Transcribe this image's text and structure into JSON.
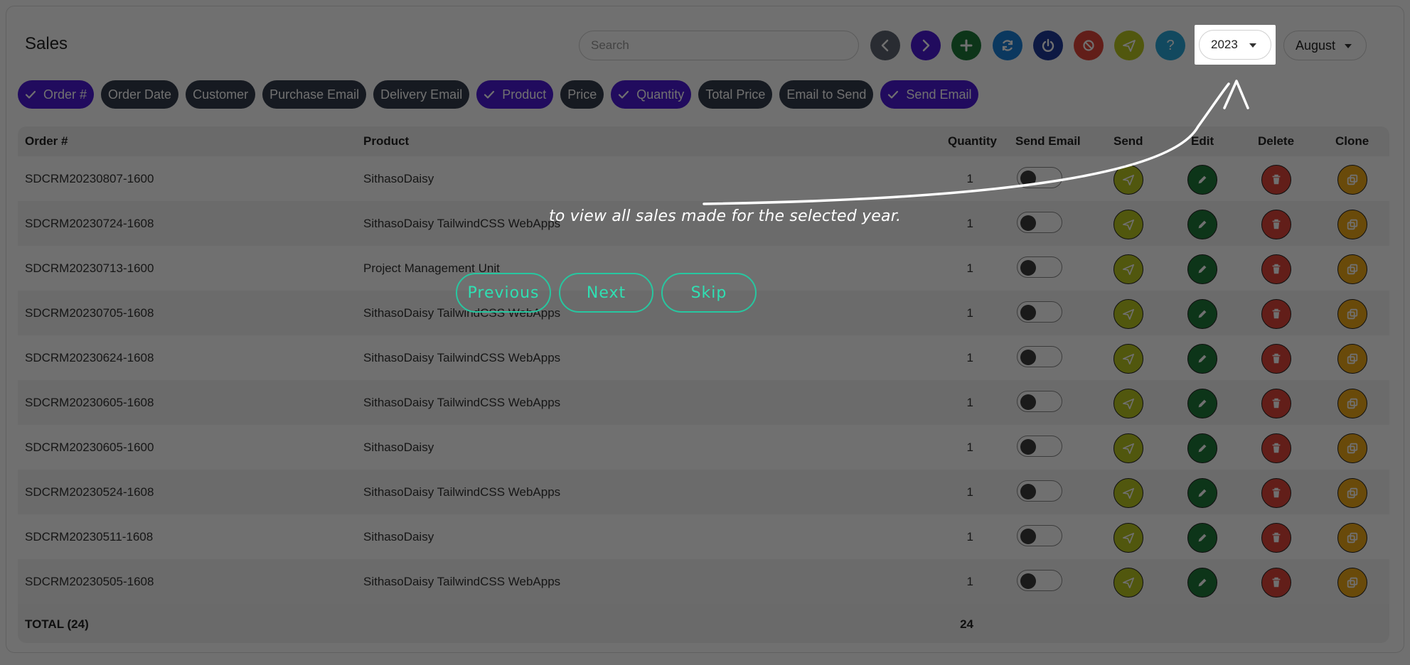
{
  "page": {
    "title": "Sales"
  },
  "search": {
    "placeholder": "Search"
  },
  "toolbar": {
    "buttons": [
      {
        "icon": "chevron-left-icon",
        "color": "#5d6472"
      },
      {
        "icon": "chevron-right-icon",
        "color": "#4c1bd6"
      },
      {
        "icon": "plus-icon",
        "color": "#1f7a3a"
      },
      {
        "icon": "refresh-icon",
        "color": "#1a7fd9"
      },
      {
        "icon": "power-icon",
        "color": "#1e3a9a"
      },
      {
        "icon": "ban-icon",
        "color": "#e0453a"
      },
      {
        "icon": "send-icon",
        "color": "#b8c620"
      },
      {
        "icon": "help-icon",
        "label": "?",
        "color": "#2aa7d8"
      }
    ]
  },
  "filters": {
    "year": "2023",
    "month": "August"
  },
  "columns_toggle": [
    {
      "label": "Order #",
      "active": true
    },
    {
      "label": "Order Date",
      "active": false
    },
    {
      "label": "Customer",
      "active": false
    },
    {
      "label": "Purchase Email",
      "active": false
    },
    {
      "label": "Delivery Email",
      "active": false
    },
    {
      "label": "Product",
      "active": true
    },
    {
      "label": "Price",
      "active": false
    },
    {
      "label": "Quantity",
      "active": true
    },
    {
      "label": "Total Price",
      "active": false
    },
    {
      "label": "Email to Send",
      "active": false
    },
    {
      "label": "Send Email",
      "active": true
    }
  ],
  "table": {
    "headers": {
      "order": "Order #",
      "product": "Product",
      "quantity": "Quantity",
      "send_email": "Send Email",
      "send": "Send",
      "edit": "Edit",
      "delete": "Delete",
      "clone": "Clone"
    },
    "rows": [
      {
        "order": "SDCRM20230807-1600",
        "product": "SithasoDaisy",
        "quantity": "1"
      },
      {
        "order": "SDCRM20230724-1608",
        "product": "SithasoDaisy TailwindCSS WebApps",
        "quantity": "1"
      },
      {
        "order": "SDCRM20230713-1600",
        "product": "Project Management Unit",
        "quantity": "1"
      },
      {
        "order": "SDCRM20230705-1608",
        "product": "SithasoDaisy TailwindCSS WebApps",
        "quantity": "1"
      },
      {
        "order": "SDCRM20230624-1608",
        "product": "SithasoDaisy TailwindCSS WebApps",
        "quantity": "1"
      },
      {
        "order": "SDCRM20230605-1608",
        "product": "SithasoDaisy TailwindCSS WebApps",
        "quantity": "1"
      },
      {
        "order": "SDCRM20230605-1600",
        "product": "SithasoDaisy",
        "quantity": "1"
      },
      {
        "order": "SDCRM20230524-1608",
        "product": "SithasoDaisy TailwindCSS WebApps",
        "quantity": "1"
      },
      {
        "order": "SDCRM20230511-1608",
        "product": "SithasoDaisy",
        "quantity": "1"
      },
      {
        "order": "SDCRM20230505-1608",
        "product": "SithasoDaisy TailwindCSS WebApps",
        "quantity": "1"
      }
    ],
    "footer": {
      "label": "TOTAL (24)",
      "quantity": "24"
    }
  },
  "action_colors": {
    "send": "#b8c620",
    "edit": "#1f7a3a",
    "delete": "#e0453a",
    "clone": "#f0a818"
  },
  "tour": {
    "text": "to view all sales made for the selected year.",
    "previous": "Previous",
    "next": "Next",
    "skip": "Skip"
  }
}
